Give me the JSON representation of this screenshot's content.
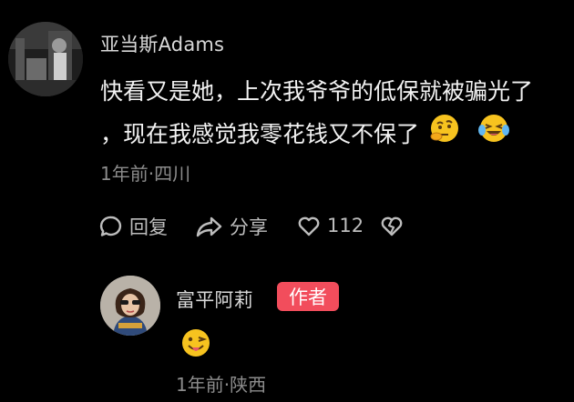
{
  "comment": {
    "username": "亚当斯Adams",
    "text_line1": "快看又是她，上次我爷爷的低保就被骗光了",
    "text_line2": "，现在我感觉我零花钱又不保了",
    "meta": "1年前·四川",
    "emojis": [
      "thinking-face-emoji",
      "laughing-tears-emoji"
    ],
    "actions": {
      "reply_label": "回复",
      "share_label": "分享",
      "like_count": "112"
    }
  },
  "reply": {
    "username": "富平阿莉",
    "badge": "作者",
    "emoji": "winking-tongue-emoji",
    "meta": "1年前·陕西"
  },
  "colors": {
    "background": "#000000",
    "badge": "#f24d5c",
    "secondary_text": "#8c8c8c",
    "emoji_yellow": "#f7c31f"
  }
}
